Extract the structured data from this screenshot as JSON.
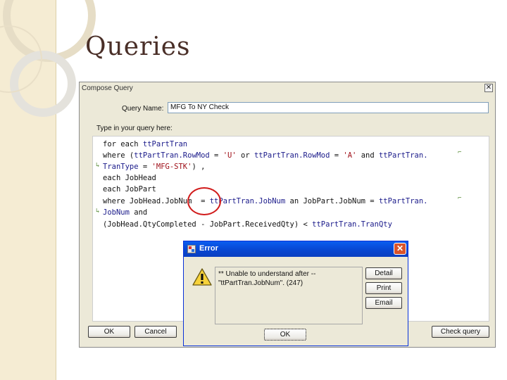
{
  "slide": {
    "title": "Queries"
  },
  "compose": {
    "title": "Compose Query",
    "close_glyph": "✕",
    "query_name_label": "Query Name:",
    "query_name_value": "MFG To NY Check",
    "type_label": "Type in your query here:",
    "buttons": {
      "ok": "OK",
      "cancel": "Cancel",
      "check": "Check query"
    },
    "code": {
      "l1_a": "for each ",
      "l1_b": "ttPartTran",
      "l2_a": "where (",
      "l2_b": "ttPartTran.RowMod",
      "l2_c": " = ",
      "l2_d": "'U'",
      "l2_e": " or ",
      "l2_f": "ttPartTran.RowMod",
      "l2_g": " = ",
      "l2_h": "'A'",
      "l2_i": " and ",
      "l2_j": "ttPartTran.",
      "l3_a": "TranType",
      "l3_b": " = ",
      "l3_c": "'MFG-STK'",
      "l3_d": ") ,",
      "l4": "each JobHead",
      "l5": "each JobPart",
      "l6_a": "where JobHead.JobNum  = ",
      "l6_b": "ttPartTran.JobNum",
      "l6_c": " an JobPart.JobNum = ",
      "l6_d": "ttPartTran.",
      "l7_a": "JobNum",
      "l7_b": " and",
      "l8_a": "(JobHead.QtyCompleted - JobPart.ReceivedQty) < ",
      "l8_b": "ttPartTran.TranQty"
    },
    "wrap_glyph": "↳",
    "wrap_end_glyph": "⌐"
  },
  "error": {
    "title": "Error",
    "close_glyph": "✕",
    "message_line1": "** Unable to understand after --",
    "message_line2": "\"ttPartTran.JobNum\". (247)",
    "buttons": {
      "detail": "Detail",
      "print": "Print",
      "email": "Email",
      "ok": "OK"
    }
  }
}
